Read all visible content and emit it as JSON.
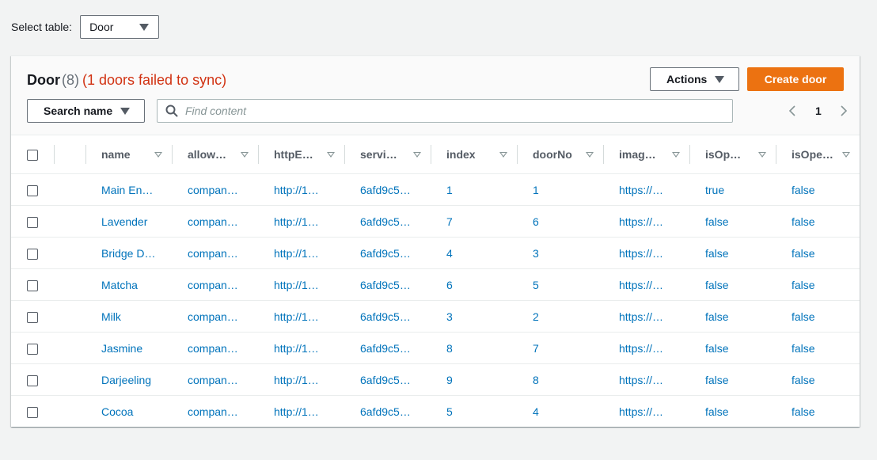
{
  "select_table": {
    "label": "Select table:",
    "value": "Door"
  },
  "panel": {
    "title": "Door",
    "count": "(8)",
    "failed": "(1 doors failed to sync)",
    "actions_label": "Actions",
    "create_label": "Create door",
    "search_name_label": "Search name",
    "find_placeholder": "Find content",
    "page": "1"
  },
  "columns": [
    "name",
    "allow…",
    "httpE…",
    "servi…",
    "index",
    "doorNo",
    "imag…",
    "isOp…",
    "isOpe…"
  ],
  "rows": [
    [
      "Main En…",
      "compan…",
      "http://1…",
      "6afd9c5…",
      "1",
      "1",
      "https://…",
      "true",
      "false"
    ],
    [
      "Lavender",
      "compan…",
      "http://1…",
      "6afd9c5…",
      "7",
      "6",
      "https://…",
      "false",
      "false"
    ],
    [
      "Bridge D…",
      "compan…",
      "http://1…",
      "6afd9c5…",
      "4",
      "3",
      "https://…",
      "false",
      "false"
    ],
    [
      "Matcha",
      "compan…",
      "http://1…",
      "6afd9c5…",
      "6",
      "5",
      "https://…",
      "false",
      "false"
    ],
    [
      "Milk",
      "compan…",
      "http://1…",
      "6afd9c5…",
      "3",
      "2",
      "https://…",
      "false",
      "false"
    ],
    [
      "Jasmine",
      "compan…",
      "http://1…",
      "6afd9c5…",
      "8",
      "7",
      "https://…",
      "false",
      "false"
    ],
    [
      "Darjeeling",
      "compan…",
      "http://1…",
      "6afd9c5…",
      "9",
      "8",
      "https://…",
      "false",
      "false"
    ],
    [
      "Cocoa",
      "compan…",
      "http://1…",
      "6afd9c5…",
      "5",
      "4",
      "https://…",
      "false",
      "false"
    ]
  ],
  "icons": {
    "search": "search-icon",
    "caret": "caret-down-icon",
    "prev": "chevron-left-icon",
    "next": "chevron-right-icon",
    "sort": "sort-icon"
  },
  "colors": {
    "accent": "#ec7211",
    "link": "#0073bb",
    "error": "#d13212"
  }
}
